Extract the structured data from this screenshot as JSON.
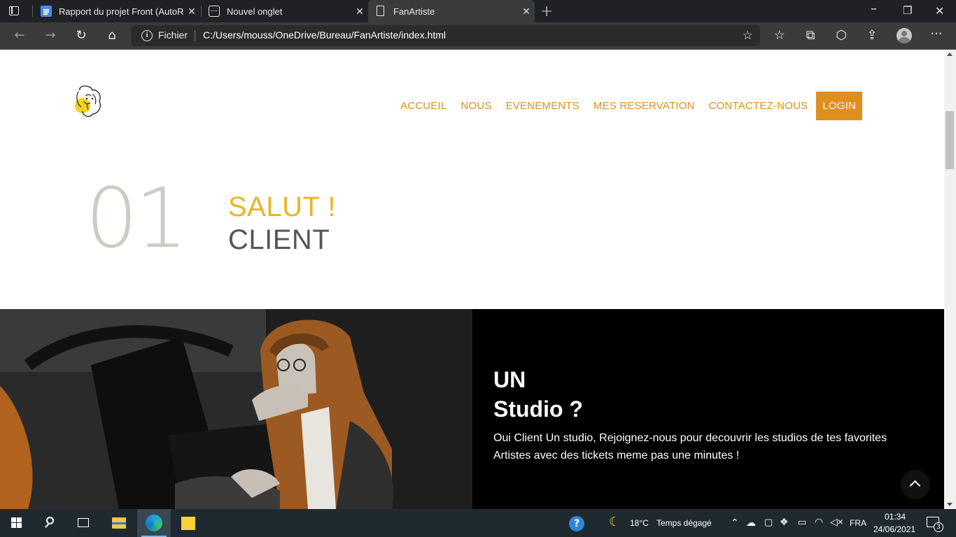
{
  "browser": {
    "tabs": [
      {
        "title": "Rapport du projet Front (AutoRe",
        "icon": "google-docs-icon"
      },
      {
        "title": "Nouvel onglet",
        "icon": "new-tab-page-icon"
      },
      {
        "title": "FanArtiste",
        "icon": "file-page-icon"
      }
    ],
    "address": {
      "scheme_label": "Fichier",
      "url": "C:/Users/mouss/OneDrive/Bureau/FanArtiste/index.html"
    }
  },
  "site": {
    "nav": [
      "ACCUEIL",
      "NOUS",
      "EVENEMENTS",
      "MES RESERVATION",
      "CONTACTEZ-NOUS"
    ],
    "login_label": "LOGIN",
    "intro": {
      "number": "01",
      "greeting": "SALUT !",
      "subtitle": "CLIENT"
    },
    "studio": {
      "title_line1": "UN",
      "title_line2": "Studio ?",
      "text": "Oui Client Un studio, Rejoignez-nous pour decouvrir les studios de tes favorites Artistes avec des tickets meme pas une minutes !"
    },
    "colors": {
      "accent": "#e08e1e",
      "yellow": "#e8b624",
      "number_gray": "#cccbc4"
    }
  },
  "taskbar": {
    "weather_temp": "18°C",
    "weather_text": "Temps dégagé",
    "language": "FRA",
    "time": "01:34",
    "date": "24/06/2021",
    "notification_count": "3"
  }
}
